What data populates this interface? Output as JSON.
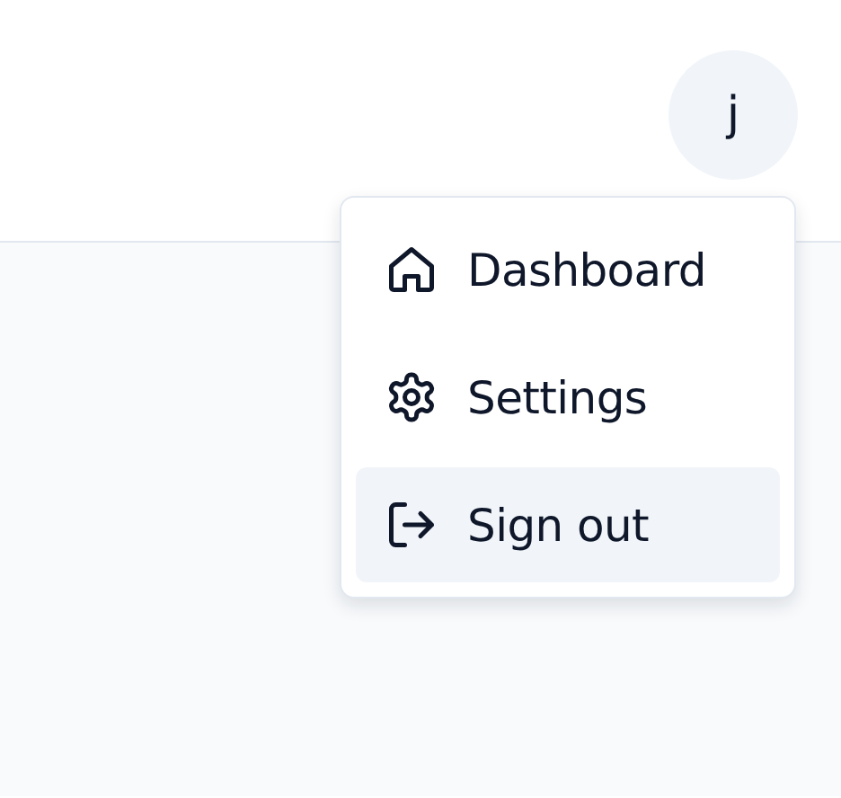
{
  "avatar": {
    "initial": "j"
  },
  "menu": {
    "items": [
      {
        "label": "Dashboard",
        "kind": "home",
        "selected": false
      },
      {
        "label": "Settings",
        "kind": "settings",
        "selected": false
      },
      {
        "label": "Sign out",
        "kind": "sign-out",
        "selected": true
      }
    ]
  }
}
